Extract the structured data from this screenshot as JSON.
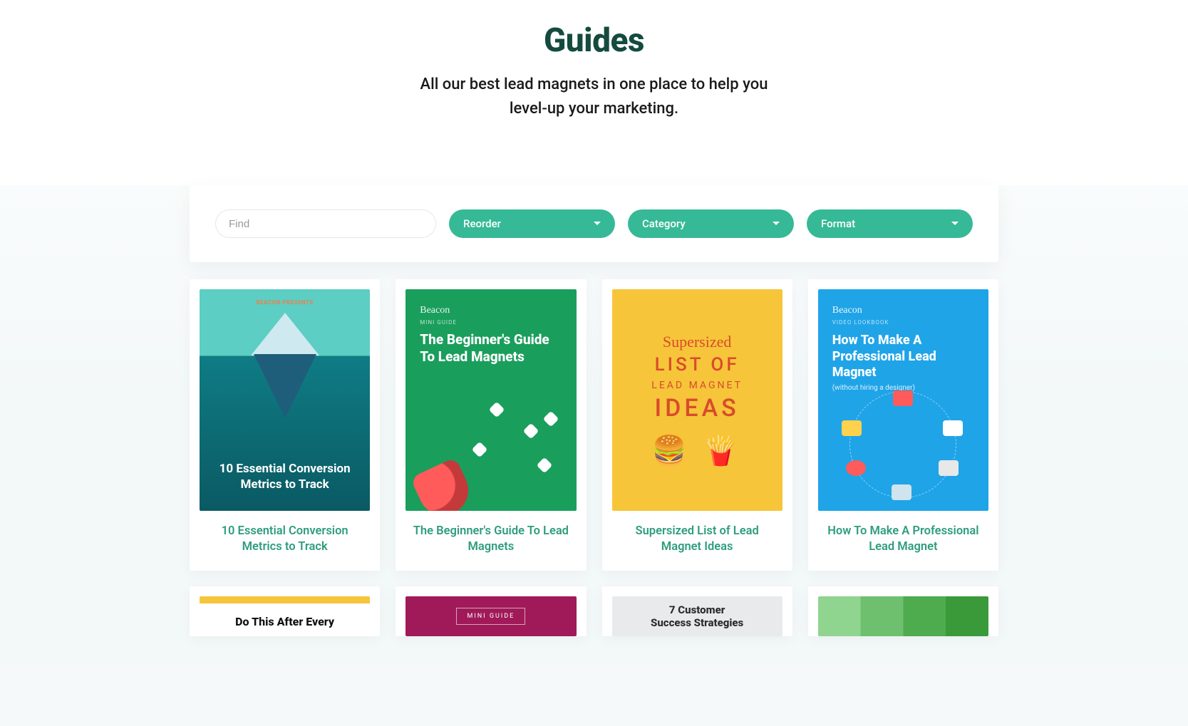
{
  "hero": {
    "title": "Guides",
    "subtitle_line1": "All our best lead magnets in one place to help you",
    "subtitle_line2": "level-up your marketing."
  },
  "filters": {
    "search_placeholder": "Find",
    "reorder_label": "Reorder",
    "category_label": "Category",
    "format_label": "Format"
  },
  "cards": [
    {
      "title": "10 Essential Conversion Metrics to Track",
      "cover": {
        "brand": "BEACON PRESENTS",
        "heading": "10 Essential Conversion Metrics to Track"
      }
    },
    {
      "title": "The Beginner's Guide To Lead Magnets",
      "cover": {
        "brand": "Beacon",
        "sub": "MINI GUIDE",
        "heading": "The Beginner's Guide To Lead Magnets"
      }
    },
    {
      "title": "Supersized List of Lead Magnet Ideas",
      "cover": {
        "line1": "Supersized",
        "line2": "LIST OF",
        "line3": "LEAD MAGNET",
        "line4": "IDEAS",
        "emoji": "🍔 🍟"
      }
    },
    {
      "title": "How To Make A Professional Lead Magnet",
      "cover": {
        "brand": "Beacon",
        "sub": "VIDEO LOOKBOOK",
        "heading": "How To Make A Professional Lead Magnet",
        "small": "(without hiring a designer)"
      }
    }
  ],
  "row2": [
    {
      "text": "Do This After Every"
    },
    {
      "text": "MINI GUIDE"
    },
    {
      "text_line1": "7 Customer",
      "text_line2": "Success Strategies"
    },
    {
      "text": ""
    }
  ]
}
